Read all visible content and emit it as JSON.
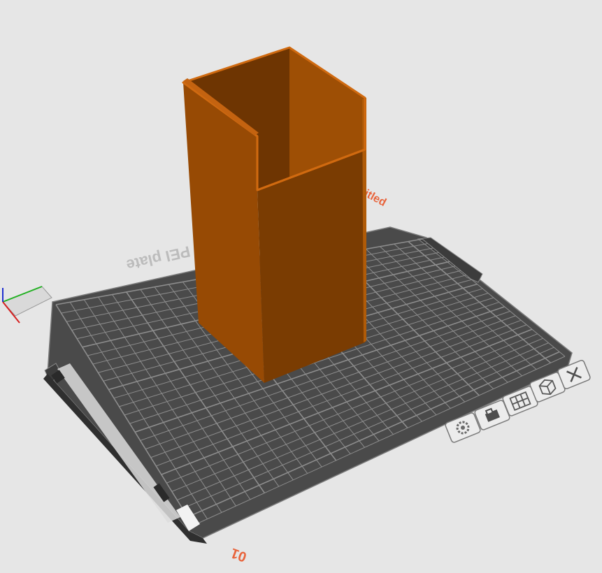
{
  "viewport": {
    "background_color": "#e6e6e6",
    "plate_color": "#484848",
    "grid_color": "#8d8d8d",
    "object_colors": {
      "light": "#9a4c04",
      "mid": "#7c3d02",
      "dark": "#6a3300",
      "edge": "#c8640c"
    }
  },
  "plate": {
    "name_label": "Bambu Textured PEI Plate",
    "visible_name_fragment": "PEI plate",
    "number_label": "01",
    "title_fragment": "itled",
    "label_color": "#e8643c"
  },
  "model": {
    "name": "hollow box"
  },
  "plate_toolbar": {
    "buttons": [
      {
        "name": "plate-settings-button",
        "icon": "gear-icon"
      },
      {
        "name": "lock-plate-button",
        "icon": "lock-icon"
      },
      {
        "name": "arrange-button",
        "icon": "arrange-icon"
      },
      {
        "name": "orient-button",
        "icon": "orient-icon"
      },
      {
        "name": "delete-plate-button",
        "icon": "close-icon"
      }
    ]
  },
  "axes": {
    "x_color": "#d62020",
    "y_color": "#20b020",
    "z_color": "#2030d0"
  }
}
